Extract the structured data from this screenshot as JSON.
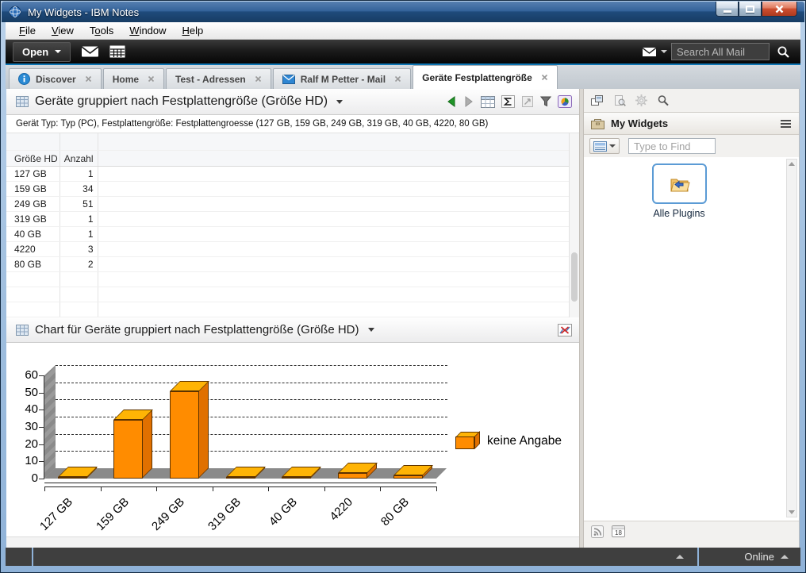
{
  "window": {
    "title": "My Widgets - IBM Notes"
  },
  "menu": {
    "items": [
      {
        "pre": "",
        "key": "F",
        "post": "ile"
      },
      {
        "pre": "",
        "key": "V",
        "post": "iew"
      },
      {
        "pre": "T",
        "key": "o",
        "post": "ols"
      },
      {
        "pre": "",
        "key": "W",
        "post": "indow"
      },
      {
        "pre": "",
        "key": "H",
        "post": "elp"
      }
    ]
  },
  "toolbar": {
    "open_label": "Open",
    "search_placeholder": "Search All Mail"
  },
  "tabs": [
    {
      "label": "Discover",
      "icon": "info",
      "active": false
    },
    {
      "label": "Home",
      "icon": null,
      "active": false
    },
    {
      "label": "Test - Adressen",
      "icon": null,
      "active": false
    },
    {
      "label": "Ralf M Petter - Mail",
      "icon": "mail",
      "active": false
    },
    {
      "label": "Geräte Festplattengröße",
      "icon": null,
      "active": true
    }
  ],
  "view": {
    "title": "Geräte gruppiert nach Festplattengröße (Größe HD)",
    "subtitle": "Gerät Typ: Typ (PC), Festplattengröße: Festplattengroesse (127 GB, 159 GB, 249 GB, 319 GB, 40 GB, 4220, 80 GB)",
    "table": {
      "columns": [
        "Größe HD",
        "Anzahl"
      ],
      "rows": [
        [
          "127 GB",
          "1"
        ],
        [
          "159 GB",
          "34"
        ],
        [
          "249 GB",
          "51"
        ],
        [
          "319 GB",
          "1"
        ],
        [
          "40 GB",
          "1"
        ],
        [
          "4220",
          "3"
        ],
        [
          "80 GB",
          "2"
        ]
      ]
    }
  },
  "chart_section": {
    "title": "Chart für Geräte gruppiert nach Festplattengröße (Größe HD)"
  },
  "chart_data": {
    "type": "bar",
    "style": "3d",
    "categories": [
      "127 GB",
      "159 GB",
      "249 GB",
      "319 GB",
      "40 GB",
      "4220",
      "80 GB"
    ],
    "values": [
      1,
      34,
      51,
      1,
      1,
      3,
      2
    ],
    "series": [
      {
        "name": "keine Angabe",
        "values": [
          1,
          34,
          51,
          1,
          1,
          3,
          2
        ]
      }
    ],
    "legend_label": "keine Angabe",
    "legend_position": "right",
    "ylim": [
      0,
      60
    ],
    "yticks": [
      0,
      10,
      20,
      30,
      40,
      50,
      60
    ],
    "grid": true,
    "bar_color": "#FF8C00",
    "bar_top_color": "#FFB405",
    "bar_side_color": "#E07000"
  },
  "sidebar": {
    "panel_title": "My Widgets",
    "find_placeholder": "Type to Find",
    "widgets": [
      {
        "label": "Alle Plugins"
      }
    ],
    "calendar_badge": "18"
  },
  "statusbar": {
    "online_label": "Online"
  }
}
